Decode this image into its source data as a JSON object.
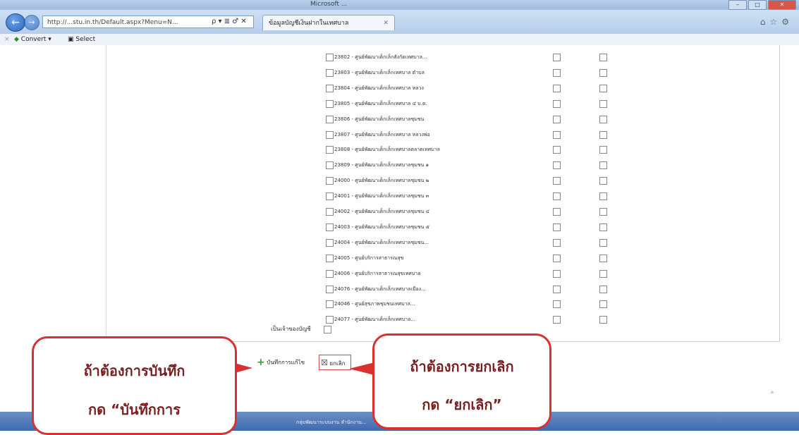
{
  "browser": {
    "window_title": "Microsoft ... ",
    "address": "http://...stu.in.th/Default.aspx?Menu=N...",
    "address_controls": "ρ ▾ ≣ ♂ ✕",
    "tab_title": "ข้อมูลบัญชีเงินฝากในเทศบาล",
    "tab_close": "✕",
    "command_bar": {
      "convert_label": "Convert",
      "select_label": "Select"
    }
  },
  "rows": [
    {
      "label": "23802 - ศูนย์พัฒนาเด็กเล็กสังกัดเทศบาล..."
    },
    {
      "label": "23803 - ศูนย์พัฒนาเด็กเล็กเทศบาล ตำบล"
    },
    {
      "label": "23804 - ศูนย์พัฒนาเด็กเล็กเทศบาล หลวง"
    },
    {
      "label": "23805 - ศูนย์พัฒนาเด็กเล็กเทศบาล ๔ บ.ต."
    },
    {
      "label": "23806 - ศูนย์พัฒนาเด็กเล็กเทศบาลชุมชน"
    },
    {
      "label": "23807 - ศูนย์พัฒนาเด็กเล็กเทศบาล หลวงพ่อ"
    },
    {
      "label": "23808 - ศูนย์พัฒนาเด็กเล็กเทศบาลตลาดเทศบาล"
    },
    {
      "label": "23809 - ศูนย์พัฒนาเด็กเล็กเทศบาลชุมชน ๑"
    },
    {
      "label": "24000 - ศูนย์พัฒนาเด็กเล็กเทศบาลชุมชน ๒"
    },
    {
      "label": "24001 - ศูนย์พัฒนาเด็กเล็กเทศบาลชุมชน ๓"
    },
    {
      "label": "24002 - ศูนย์พัฒนาเด็กเล็กเทศบาลชุมชน ๔"
    },
    {
      "label": "24003 - ศูนย์พัฒนาเด็กเล็กเทศบาลชุมชน ๕"
    },
    {
      "label": "24004 - ศูนย์พัฒนาเด็กเล็กเทศบาลชุมชน..."
    },
    {
      "label": "24005 - ศูนย์บริการสาธารณสุข"
    },
    {
      "label": "24006 - ศูนย์บริการสาธารณสุขเทศบาล"
    },
    {
      "label": "24076 - ศูนย์พัฒนาเด็กเล็กเทศบาลเมือง..."
    },
    {
      "label": "24046 - ศูนย์สุขภาพชุมชนเทศบาล..."
    },
    {
      "label": "24077 - ศูนย์พัฒนาเด็กเล็กเทศบาล..."
    }
  ],
  "summary_label": "เป็นเจ้าของบัญชี",
  "buttons": {
    "save_label": "บันทึกการแก้ไข",
    "cancel_label": "ยกเลิก"
  },
  "status_text": "กลุ่มพัฒนาระบบงาน สำนักงาน...",
  "callouts": {
    "left": {
      "line1": "ถ้าต้องการบันทึก",
      "line2": "กด “บันทึกการ"
    },
    "right": {
      "line1": "ถ้าต้องการยกเลิก",
      "line2": "กด “ยกเลิก”"
    }
  }
}
